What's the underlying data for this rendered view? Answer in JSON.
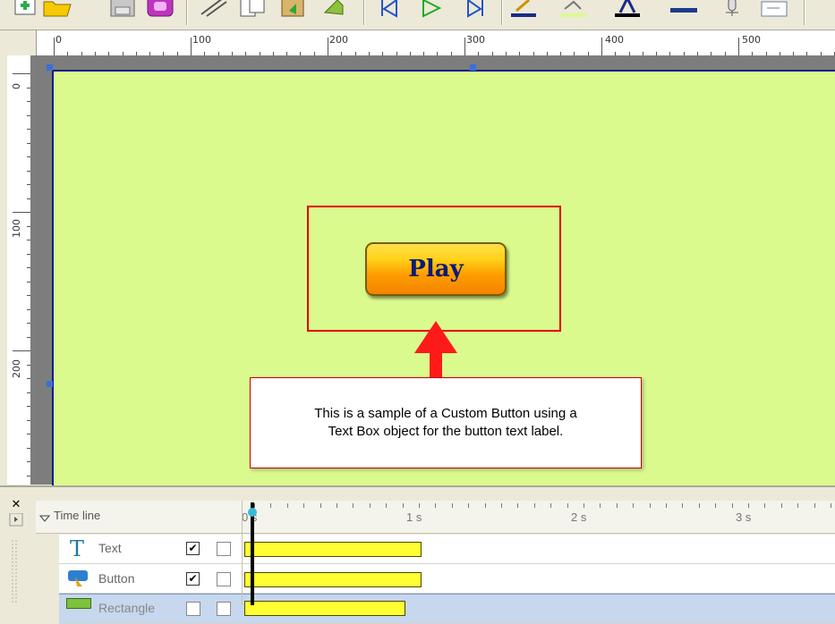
{
  "toolbar": {
    "icons": [
      "new-icon",
      "open-folder-icon",
      "save-icon",
      "publish-icon",
      "cut-icon",
      "copy-icon",
      "paste-icon",
      "undo-icon",
      "go-first-icon",
      "play-icon",
      "go-last-icon",
      "line-color-icon",
      "fill-color-icon",
      "font-color-icon",
      "line-style-icon",
      "microphone-icon",
      "properties-icon"
    ]
  },
  "ruler": {
    "h_labels": [
      "0",
      "100",
      "200",
      "300",
      "400",
      "500"
    ],
    "v_labels": [
      "0",
      "100",
      "200"
    ]
  },
  "stage": {
    "background_color": "#dafa8e",
    "play_button_label": "Play",
    "callout_text": "This is a sample of a Custom Button using a\nText Box object for the button text label."
  },
  "timeline": {
    "header_label": "Time line",
    "time_labels": [
      "0 s",
      "1 s",
      "2 s",
      "3 s"
    ],
    "rows": [
      {
        "label": "Text",
        "visible_checked": true
      },
      {
        "label": "Button",
        "visible_checked": true
      },
      {
        "label": "Rectangle",
        "visible_checked": false
      }
    ],
    "check_mark": "✔",
    "close_glyph": "✕"
  }
}
